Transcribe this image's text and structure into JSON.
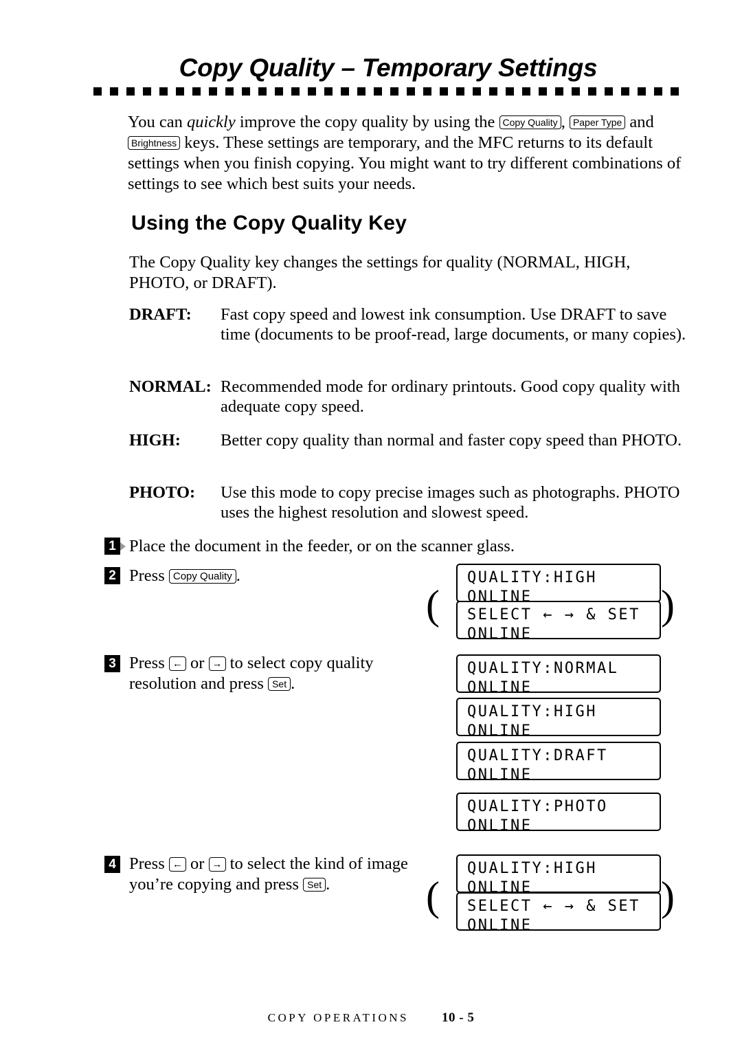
{
  "title": "Copy Quality – Temporary Settings",
  "intro": {
    "t1": "You can ",
    "t2": "quickly",
    "t3": " improve the copy quality by using the ",
    "key_copy_quality": "Copy Quality",
    "t4": ", ",
    "key_paper_type": "Paper Type",
    "t5": " and",
    "key_brightness": "Brightness",
    "t6": " keys. These settings are temporary, and the MFC returns to its default settings when you finish copying. You might want to try different combinations of settings to see which best suits your needs."
  },
  "section_head": "Using the Copy Quality Key",
  "quality_intro": "The Copy Quality key changes the settings for quality (NORMAL, HIGH, PHOTO, or DRAFT).",
  "definitions": [
    {
      "term": "DRAFT:",
      "desc": "Fast copy speed and lowest ink consumption. Use DRAFT to save time (documents to be proof-read, large documents, or many copies)."
    },
    {
      "term": "NORMAL:",
      "desc": "Recommended mode for ordinary printouts. Good copy quality with adequate copy speed."
    },
    {
      "term": "HIGH:",
      "desc": "Better copy quality than normal and faster copy speed than PHOTO."
    },
    {
      "term": "PHOTO:",
      "desc": "Use this mode to copy precise images such as photographs. PHOTO uses the highest resolution and slowest speed."
    }
  ],
  "steps": [
    {
      "num": "1",
      "text": "Place the document in the feeder, or on the scanner glass."
    },
    {
      "num": "2",
      "pre": "Press ",
      "key": "Copy Quality",
      "post": "."
    },
    {
      "num": "3",
      "pre": "Press ",
      "key_left": "←",
      "mid": " or ",
      "key_right": "→",
      "post": " to select copy quality resolution and press ",
      "key_set": "Set",
      "end": "."
    },
    {
      "num": "4",
      "pre": "Press ",
      "key_left": "←",
      "mid": " or ",
      "key_right": "→",
      "post": " to select the kind of image you’re copying and press ",
      "key_set": "Set",
      "end": "."
    }
  ],
  "lcds": {
    "step2_a": {
      "line1": "QUALITY:HIGH",
      "line2": "ONLINE"
    },
    "step2_b": {
      "line1": "SELECT ← → & SET",
      "line2": "ONLINE"
    },
    "step3_a": {
      "line1": "QUALITY:NORMAL",
      "line2": "ONLINE"
    },
    "step3_b": {
      "line1": "QUALITY:HIGH",
      "line2": "ONLINE"
    },
    "step3_c": {
      "line1": "QUALITY:DRAFT",
      "line2": "ONLINE"
    },
    "step3_d": {
      "line1": "QUALITY:PHOTO",
      "line2": "ONLINE"
    },
    "step4_a": {
      "line1": "QUALITY:HIGH",
      "line2": "ONLINE"
    },
    "step4_b": {
      "line1": "SELECT ← → & SET",
      "line2": "ONLINE"
    }
  },
  "footer": {
    "label": "COPY OPERATIONS",
    "page": "10 - 5"
  }
}
